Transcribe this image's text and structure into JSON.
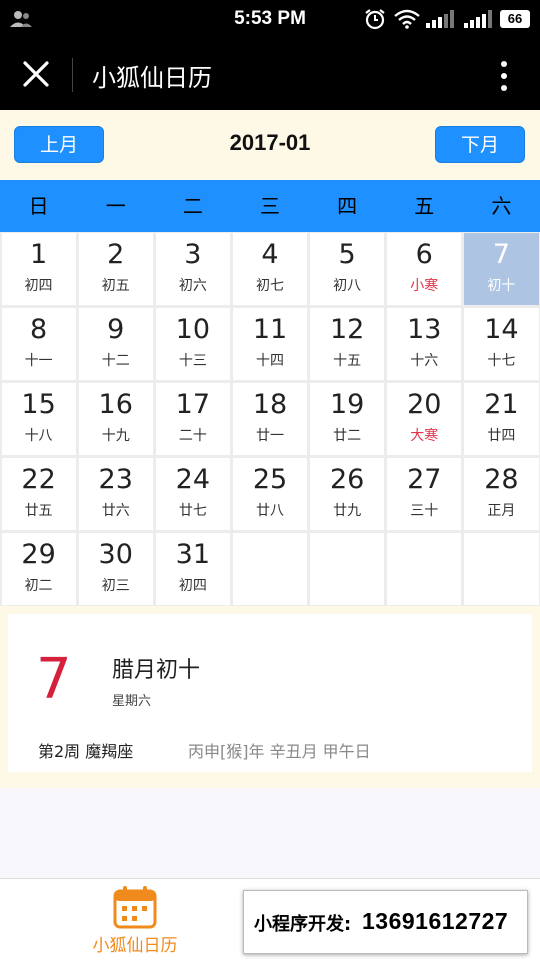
{
  "status_bar": {
    "time": "5:53 PM",
    "battery": "66"
  },
  "title_bar": {
    "title": "小狐仙日历"
  },
  "month_nav": {
    "prev_label": "上月",
    "next_label": "下月",
    "month": "2017-01"
  },
  "weekdays": [
    "日",
    "一",
    "二",
    "三",
    "四",
    "五",
    "六"
  ],
  "days": [
    {
      "day": "1",
      "lunar": "初四"
    },
    {
      "day": "2",
      "lunar": "初五"
    },
    {
      "day": "3",
      "lunar": "初六"
    },
    {
      "day": "4",
      "lunar": "初七"
    },
    {
      "day": "5",
      "lunar": "初八"
    },
    {
      "day": "6",
      "lunar": "小寒",
      "term": true
    },
    {
      "day": "7",
      "lunar": "初十",
      "selected": true
    },
    {
      "day": "8",
      "lunar": "十一"
    },
    {
      "day": "9",
      "lunar": "十二"
    },
    {
      "day": "10",
      "lunar": "十三"
    },
    {
      "day": "11",
      "lunar": "十四"
    },
    {
      "day": "12",
      "lunar": "十五"
    },
    {
      "day": "13",
      "lunar": "十六"
    },
    {
      "day": "14",
      "lunar": "十七"
    },
    {
      "day": "15",
      "lunar": "十八"
    },
    {
      "day": "16",
      "lunar": "十九"
    },
    {
      "day": "17",
      "lunar": "二十"
    },
    {
      "day": "18",
      "lunar": "廿一"
    },
    {
      "day": "19",
      "lunar": "廿二"
    },
    {
      "day": "20",
      "lunar": "大寒",
      "term": true
    },
    {
      "day": "21",
      "lunar": "廿四"
    },
    {
      "day": "22",
      "lunar": "廿五"
    },
    {
      "day": "23",
      "lunar": "廿六"
    },
    {
      "day": "24",
      "lunar": "廿七"
    },
    {
      "day": "25",
      "lunar": "廿八"
    },
    {
      "day": "26",
      "lunar": "廿九"
    },
    {
      "day": "27",
      "lunar": "三十"
    },
    {
      "day": "28",
      "lunar": "正月"
    },
    {
      "day": "29",
      "lunar": "初二"
    },
    {
      "day": "30",
      "lunar": "初三"
    },
    {
      "day": "31",
      "lunar": "初四"
    }
  ],
  "trailing_empty_cells": 4,
  "detail": {
    "day": "7",
    "lunar_date": "腊月初十",
    "weekday": "星期六",
    "week_zodiac": "第2周 魔羯座",
    "ganzhi": "丙申[猴]年 辛丑月 甲午日"
  },
  "tab_bar": {
    "label": "小狐仙日历"
  },
  "promo": {
    "label": "小程序开发:",
    "phone": "13691612727"
  },
  "colors": {
    "accent_blue": "#1e90ff",
    "selected_cell": "#adc4e3",
    "solar_term_red": "#e2324a",
    "detail_day_red": "#d5213c",
    "tab_orange": "#f08a1c",
    "nav_background": "#fdf9e6"
  }
}
